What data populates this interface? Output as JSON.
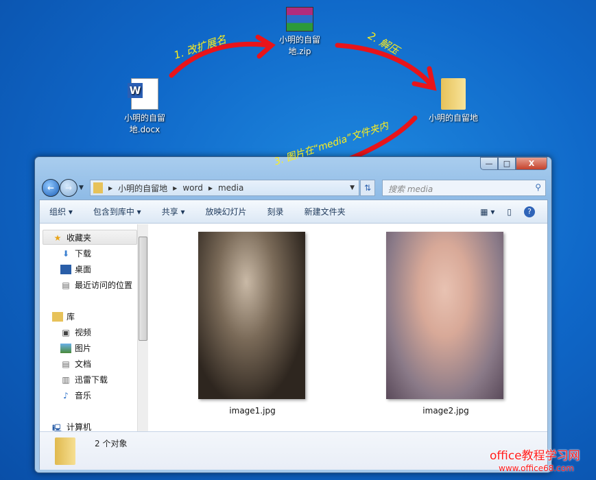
{
  "desktop": {
    "icons": [
      {
        "label": "小明的自留地.docx"
      },
      {
        "label": "小明的自留地.zip"
      },
      {
        "label": "小明的自留地"
      }
    ]
  },
  "annotations": {
    "step1": "1. 改扩展名",
    "step2": "2. 解压",
    "step3": "3. 图片在“media”文件夹内"
  },
  "window": {
    "controls": {
      "minimize": "—",
      "maximize": "□",
      "close": "X"
    },
    "address": {
      "segments": [
        "小明的自留地",
        "word",
        "media"
      ]
    },
    "search_placeholder": "搜索 media",
    "toolbar": [
      "组织 ▾",
      "包含到库中 ▾",
      "共享 ▾",
      "放映幻灯片",
      "刻录",
      "新建文件夹"
    ],
    "sidebar": {
      "favorites": "收藏夹",
      "fav_items": [
        "下载",
        "桌面",
        "最近访问的位置"
      ],
      "libraries": "库",
      "lib_items": [
        "视频",
        "图片",
        "文档",
        "迅雷下载",
        "音乐"
      ],
      "computer": "计算机"
    },
    "files": [
      {
        "name": "image1.jpg"
      },
      {
        "name": "image2.jpg"
      }
    ],
    "status": "2 个对象"
  },
  "watermark": {
    "title": "office教程学习网",
    "url": "www.office68.com"
  },
  "colors": {
    "arrow": "#e8141a",
    "annotation": "#ffef1a"
  }
}
